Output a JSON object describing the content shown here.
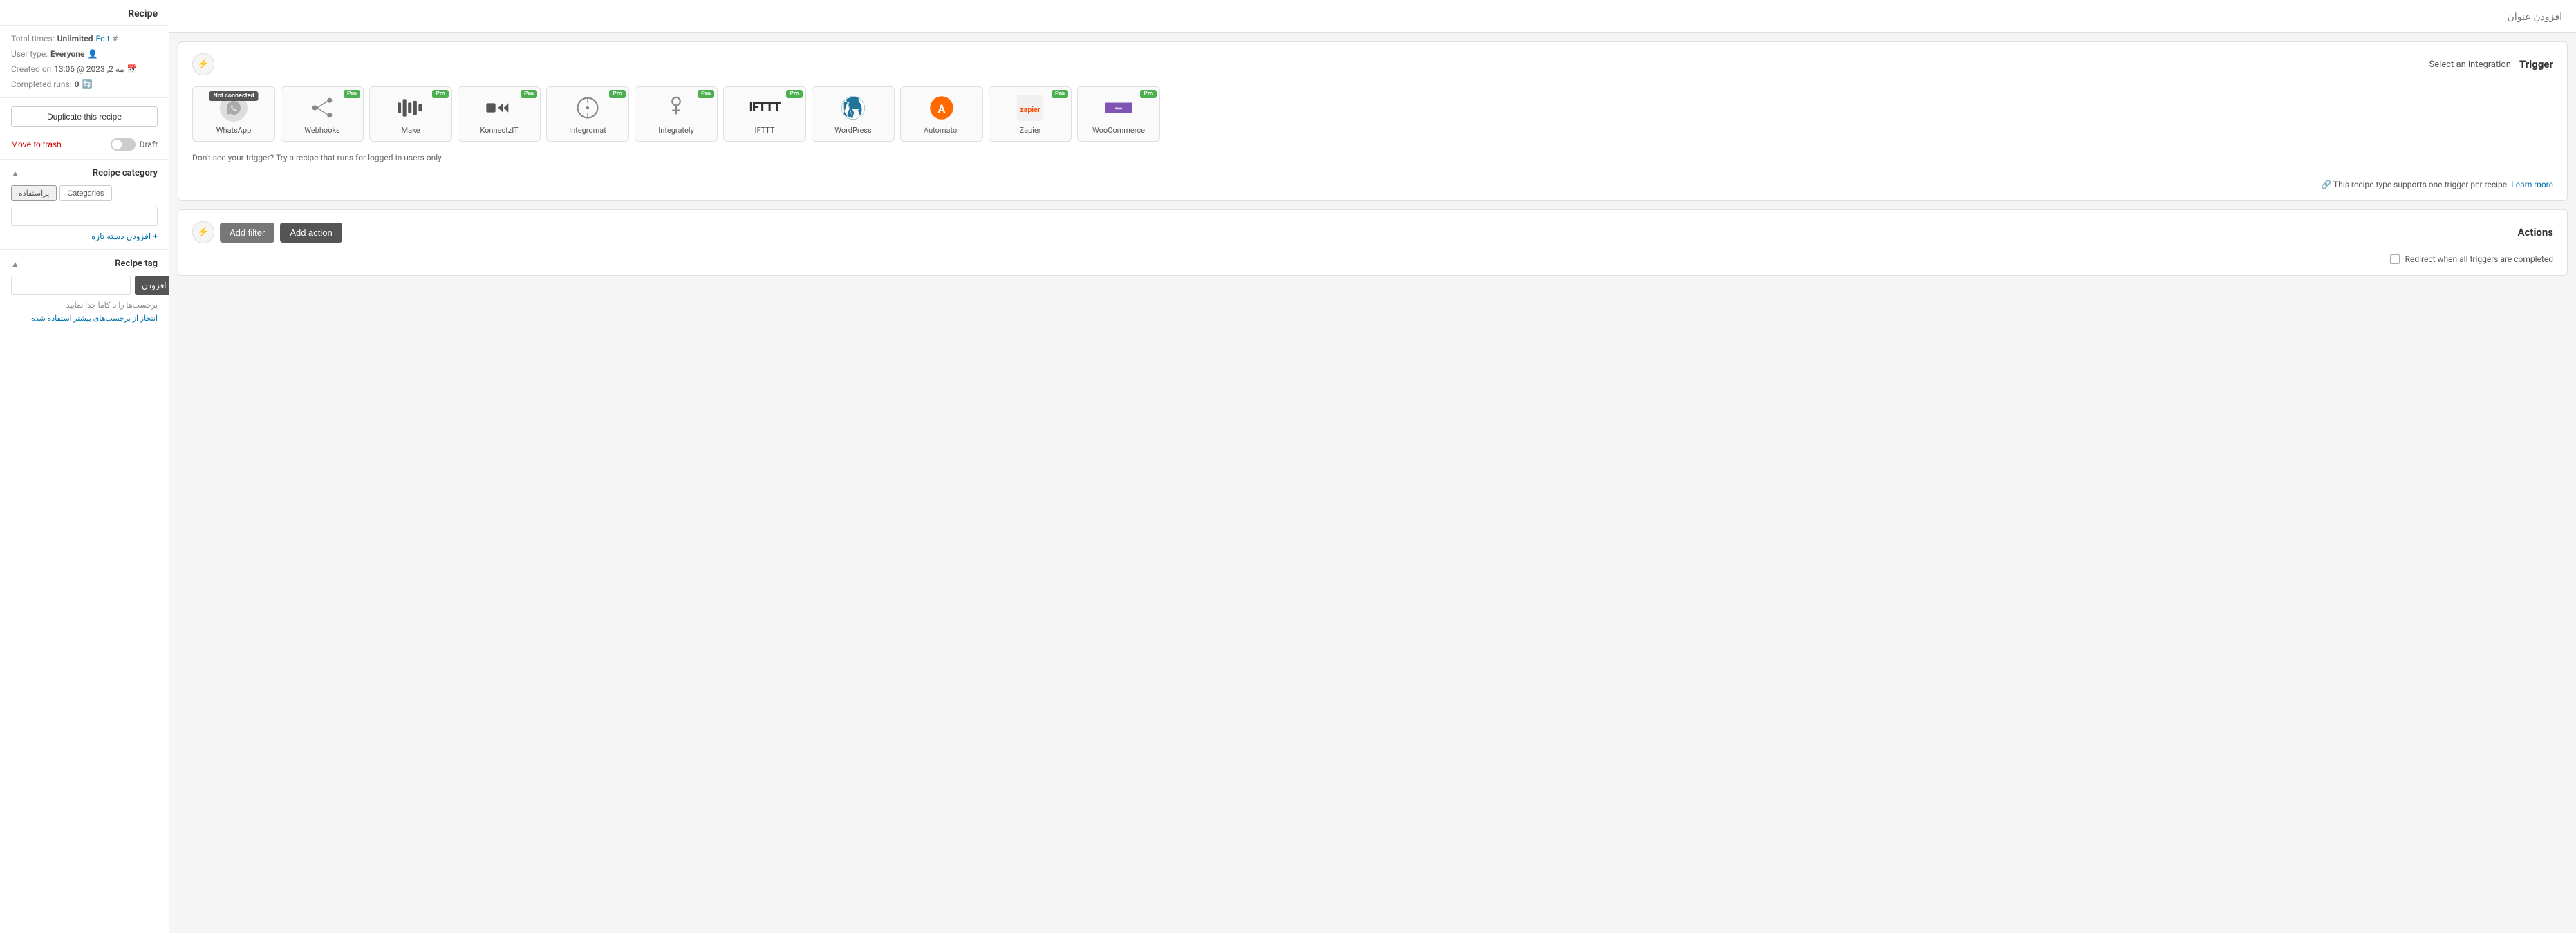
{
  "sidebar": {
    "title": "Recipe",
    "meta": {
      "total_times_label": "Total times:",
      "total_times_value": "Unlimited",
      "edit_label": "Edit",
      "user_type_label": "User type:",
      "user_type_value": "Everyone",
      "created_label": "Created on",
      "created_date": "مه 2, 2023 @ 13:06",
      "completed_runs_label": "Completed runs:",
      "completed_runs_value": "0"
    },
    "duplicate_btn": "Duplicate this recipe",
    "move_to_trash": "Move to trash",
    "draft_label": "Draft",
    "recipe_category": {
      "title": "Recipe category",
      "tab_persian": "پراستفاده",
      "tab_categories": "Categories",
      "add_link": "+ افزودن دسته تازه"
    },
    "recipe_tag": {
      "title": "Recipe tag",
      "add_btn": "افزودن",
      "hint": "برچسب‌ها را با کاما جدا نمایید",
      "select_link": "انتخاز از برچسب‌های بیشتر استفاده شده"
    }
  },
  "main": {
    "title_placeholder": "افزودن عنوان",
    "trigger": {
      "title": "Trigger",
      "select_label": "Select an integration",
      "integrations": [
        {
          "id": "whatsapp",
          "name": "WhatsApp",
          "not_connected": true,
          "pro": false
        },
        {
          "id": "webhooks",
          "name": "Webhooks",
          "pro": true
        },
        {
          "id": "make",
          "name": "Make",
          "pro": true
        },
        {
          "id": "konnectzit",
          "name": "KonnectzIT",
          "pro": true
        },
        {
          "id": "integromat",
          "name": "Integromat",
          "pro": true
        },
        {
          "id": "integrately",
          "name": "Integrately",
          "pro": true
        },
        {
          "id": "ifttt",
          "name": "IFTTT",
          "pro": true
        },
        {
          "id": "wordpress",
          "name": "WordPress",
          "pro": false
        },
        {
          "id": "automator",
          "name": "Automator",
          "pro": false
        },
        {
          "id": "zapier",
          "name": "Zapier",
          "pro": true
        },
        {
          "id": "woocommerce",
          "name": "WooCommerce",
          "pro": true
        }
      ],
      "hint": "Don't see your trigger? Try a recipe that runs for logged-in users only.",
      "footer_text": "This recipe type supports one trigger per recipe.",
      "learn_more": "Learn more"
    },
    "actions": {
      "title": "Actions",
      "add_filter_btn": "Add filter",
      "add_action_btn": "Add action",
      "redirect_label": "Redirect when all triggers are completed"
    }
  }
}
